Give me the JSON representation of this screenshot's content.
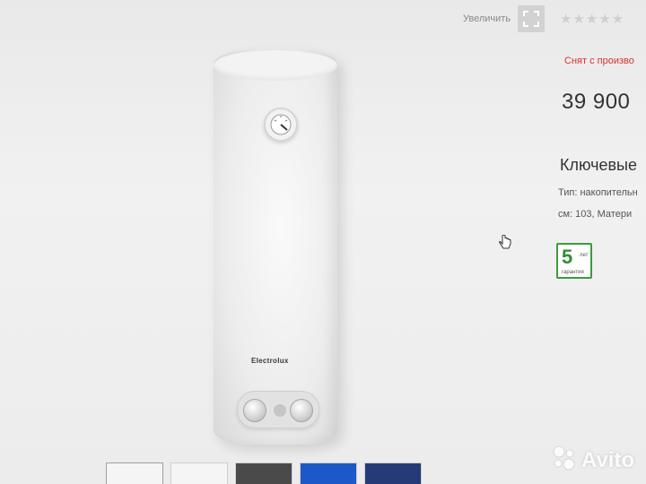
{
  "toolbar": {
    "zoom_label": "Увеличить",
    "zoom_icon": "expand-icon",
    "rating_stars": "★★★★★"
  },
  "product": {
    "brand": "Electrolux",
    "status": "Снят с произво",
    "price": "39 900"
  },
  "specs": {
    "title": "Ключевые",
    "line1": "Тип: накопительн",
    "line2": "см: 103, Матери"
  },
  "warranty": {
    "number": "5",
    "unit": "лет",
    "label": "гарантия",
    "color": "#2f8f2f"
  },
  "thumbnails": [
    "white",
    "white",
    "dark",
    "blue",
    "navy"
  ],
  "watermark": {
    "text": "Avito",
    "icon": "avito-logo-icon"
  }
}
